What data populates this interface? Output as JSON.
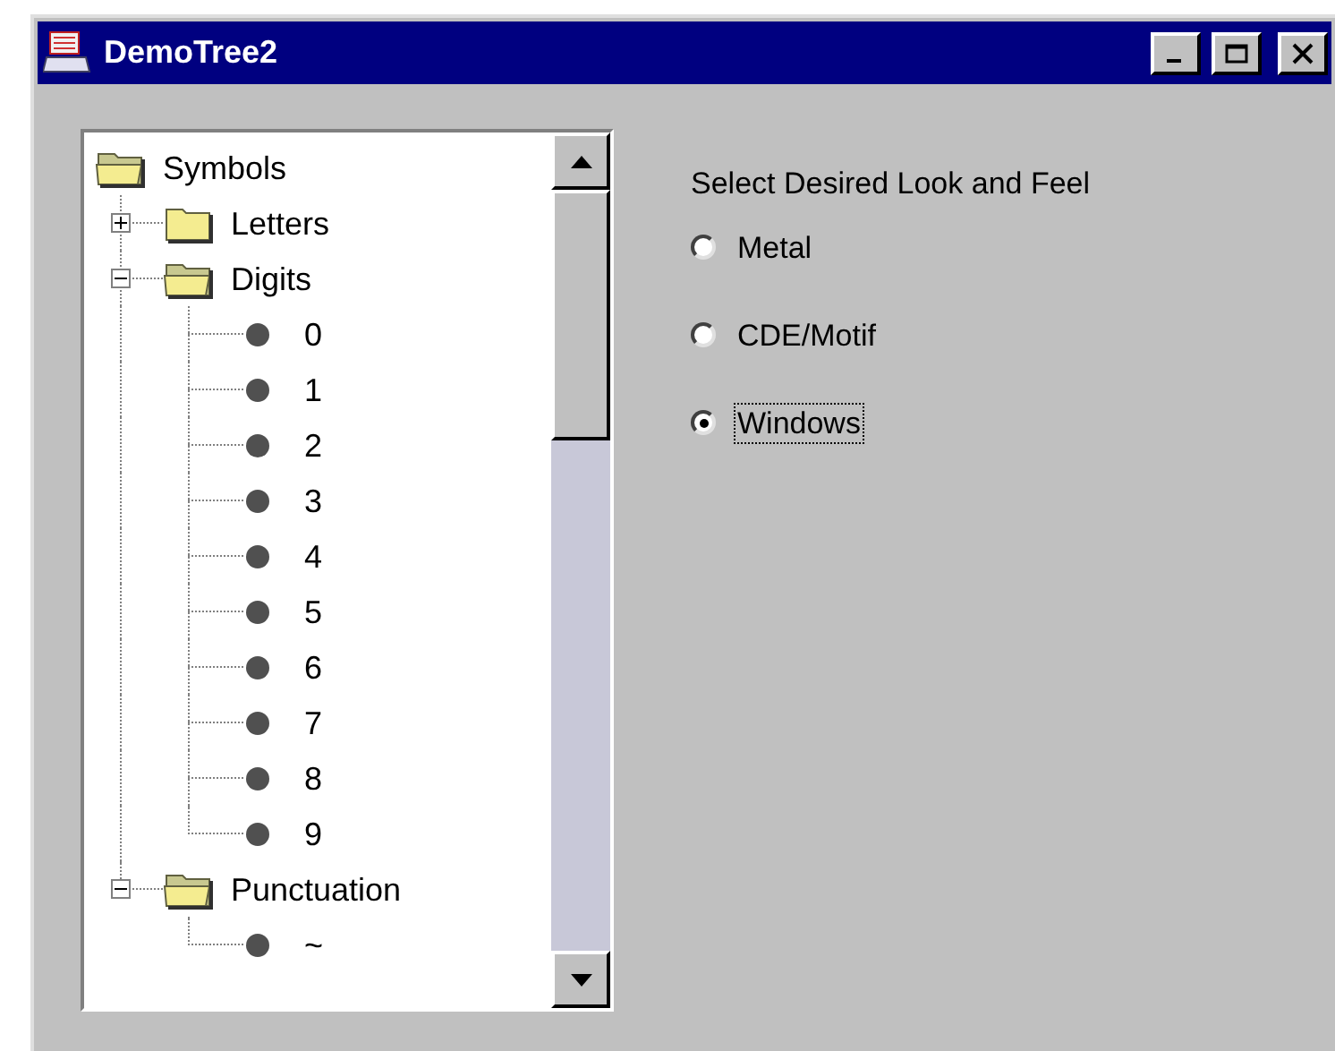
{
  "window": {
    "title": "DemoTree2"
  },
  "tree": {
    "nodes": [
      {
        "label": "Symbols",
        "kind": "folder",
        "expanded": true,
        "children": [
          {
            "label": "Letters",
            "kind": "folder",
            "expanded": false
          },
          {
            "label": "Digits",
            "kind": "folder",
            "expanded": true,
            "children": [
              {
                "label": "0",
                "kind": "leaf"
              },
              {
                "label": "1",
                "kind": "leaf"
              },
              {
                "label": "2",
                "kind": "leaf"
              },
              {
                "label": "3",
                "kind": "leaf"
              },
              {
                "label": "4",
                "kind": "leaf"
              },
              {
                "label": "5",
                "kind": "leaf"
              },
              {
                "label": "6",
                "kind": "leaf"
              },
              {
                "label": "7",
                "kind": "leaf"
              },
              {
                "label": "8",
                "kind": "leaf"
              },
              {
                "label": "9",
                "kind": "leaf"
              }
            ]
          },
          {
            "label": "Punctuation",
            "kind": "folder",
            "expanded": true,
            "children": [
              {
                "label": "~",
                "kind": "leaf"
              }
            ]
          }
        ]
      }
    ]
  },
  "look_and_feel": {
    "heading": "Select Desired Look and Feel",
    "options": [
      {
        "label": "Metal",
        "selected": false,
        "focused": false
      },
      {
        "label": "CDE/Motif",
        "selected": false,
        "focused": false
      },
      {
        "label": "Windows",
        "selected": true,
        "focused": true
      }
    ]
  }
}
